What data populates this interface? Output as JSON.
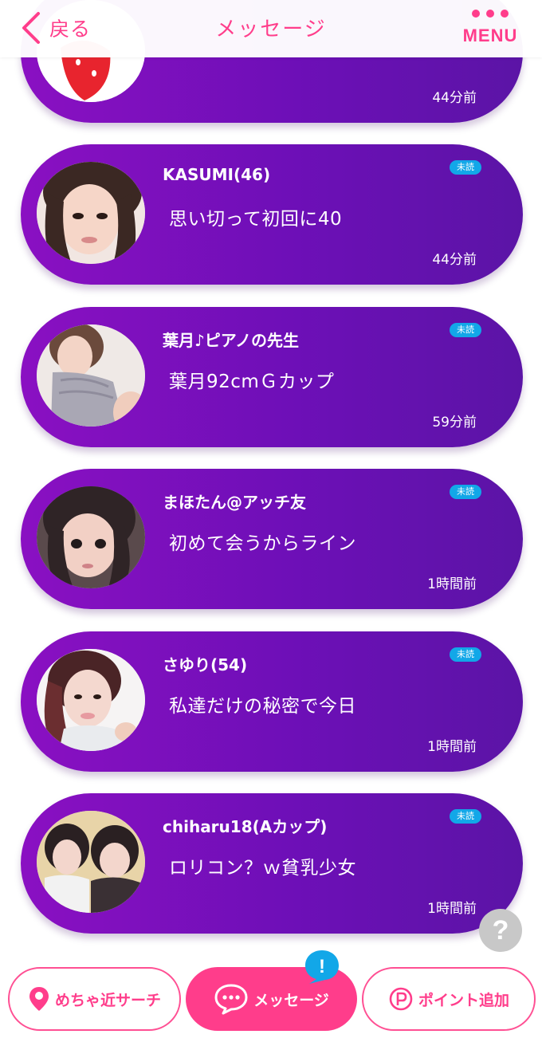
{
  "header": {
    "back_label": "戻る",
    "title": "メッセージ",
    "menu_label": "MENU"
  },
  "colors": {
    "accent_pink": "#ff3d8b",
    "card_purple": "#6d0fb7",
    "unread_blue": "#12a7e8"
  },
  "messages": [
    {
      "name": "",
      "preview": "",
      "time": "44分前",
      "unread": false,
      "avatar": "strawberry-avatar"
    },
    {
      "name": "KASUMI(46)",
      "preview": "思い切って初回に40",
      "time": "44分前",
      "unread": true,
      "unread_label": "未読"
    },
    {
      "name": "葉月♪ピアノの先生",
      "preview": "葉月92cmＧカップ",
      "time": "59分前",
      "unread": true,
      "unread_label": "未読"
    },
    {
      "name": "まほたん@アッチ友",
      "preview": "初めて会うからライン",
      "time": "1時間前",
      "unread": true,
      "unread_label": "未読"
    },
    {
      "name": "さゆり(54)",
      "preview": "私達だけの秘密で今日",
      "time": "1時間前",
      "unread": true,
      "unread_label": "未読"
    },
    {
      "name": "chiharu18(Aカップ)",
      "preview": "ロリコン？ｗ貧乳少女",
      "time": "1時間前",
      "unread": true,
      "unread_label": "未読"
    }
  ],
  "help": {
    "label": "?"
  },
  "bottom_nav": {
    "search_label": "めちゃ近サーチ",
    "message_label": "メッセージ",
    "points_label": "ポイント追加",
    "alert_label": "!"
  }
}
